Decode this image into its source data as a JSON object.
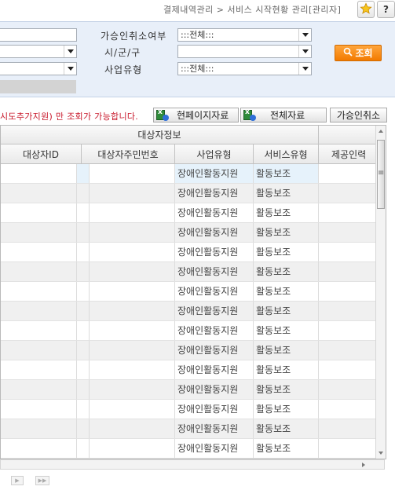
{
  "breadcrumb": "결제내역관리 > 서비스 시작현황 관리[관리자]",
  "search": {
    "field1_value": "",
    "field2_value": "",
    "field3_value": "",
    "cancel_label": "가승인취소여부",
    "cancel_value": ":::전체:::",
    "region_label": "시/군/구",
    "region_value": "",
    "biz_type_label": "사업유형",
    "biz_type_value": ":::전체:::",
    "search_button": "조회"
  },
  "notice": "시도추가지원) 만 조회가 가능합니다.",
  "toolbar": {
    "current_page_export": "현페이지자료",
    "all_export": "전체자료",
    "cancel_approval": "가승인취소"
  },
  "grid": {
    "group_header": "대상자정보",
    "columns": [
      "대상자ID",
      "대상자주민번호",
      "사업유형",
      "서비스유형",
      "제공인력"
    ],
    "rows": [
      {
        "biz_type": "장애인활동지원",
        "service_type": "활동보조"
      },
      {
        "biz_type": "장애인활동지원",
        "service_type": "활동보조"
      },
      {
        "biz_type": "장애인활동지원",
        "service_type": "활동보조"
      },
      {
        "biz_type": "장애인활동지원",
        "service_type": "활동보조"
      },
      {
        "biz_type": "장애인활동지원",
        "service_type": "활동보조"
      },
      {
        "biz_type": "장애인활동지원",
        "service_type": "활동보조"
      },
      {
        "biz_type": "장애인활동지원",
        "service_type": "활동보조"
      },
      {
        "biz_type": "장애인활동지원",
        "service_type": "활동보조"
      },
      {
        "biz_type": "장애인활동지원",
        "service_type": "활동보조"
      },
      {
        "biz_type": "장애인활동지원",
        "service_type": "활동보조"
      },
      {
        "biz_type": "장애인활동지원",
        "service_type": "활동보조"
      },
      {
        "biz_type": "장애인활동지원",
        "service_type": "활동보조"
      },
      {
        "biz_type": "장애인활동지원",
        "service_type": "활동보조"
      },
      {
        "biz_type": "장애인활동지원",
        "service_type": "활동보조"
      },
      {
        "biz_type": "장애인활동지원",
        "service_type": "활동보조"
      }
    ]
  },
  "icons": {
    "star": "star-icon",
    "help": "help-icon",
    "search": "magnifier-icon",
    "excel": "excel-icon",
    "next_page": "next-page-icon",
    "last_page": "last-page-icon"
  },
  "colors": {
    "accent_orange": "#f28c1a",
    "notice_red": "#c8182b",
    "panel_bg": "#e8eff9",
    "selected_row": "#e6f2fb"
  }
}
